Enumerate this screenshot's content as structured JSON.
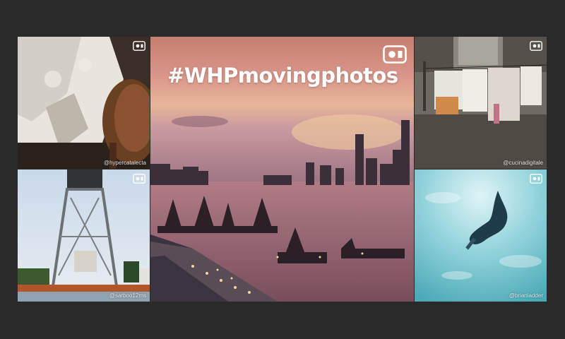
{
  "feature": {
    "hashtag": "#WHPmovingphotos",
    "accent_color": "#ffffff",
    "video_icon": "video-camera-icon"
  },
  "tiles": [
    {
      "credit": "@hypercatalecta",
      "subject": "tablecloth and wooden chair in dappled sunlight"
    },
    {
      "credit": "@cucinadigitale",
      "subject": "laundry hanging on a line"
    },
    {
      "credit": "@sarboo12ms",
      "subject": "steel lift bridge tower"
    },
    {
      "credit": "@brianladder",
      "subject": "diver underwater"
    }
  ]
}
